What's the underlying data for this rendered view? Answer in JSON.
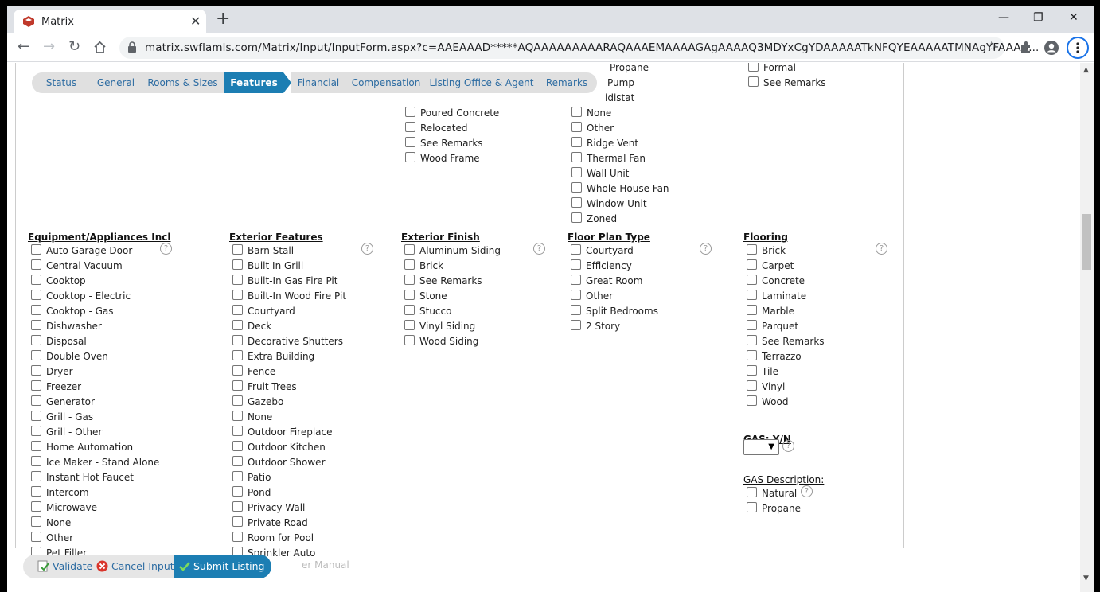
{
  "browser": {
    "tab_title": "Matrix",
    "url": "matrix.swflamls.com/Matrix/Input/InputForm.aspx?c=AAEAAAD*****AQAAAAAAAAARAQAAAEMAAAAGAgAAAAQ3MDYxCgYDAAAAATkNFQYEAAAAATMNAgYFAAAA...",
    "minimize": "—",
    "restore": "❐",
    "close": "✕",
    "new_tab": "+",
    "tab_close": "✕"
  },
  "steps": [
    "Status",
    "General",
    "Rooms & Sizes",
    "Features",
    "Financial",
    "Compensation",
    "Listing Office & Agent",
    "Remarks"
  ],
  "active_step": "Features",
  "top_partial": {
    "col3": [
      "Poured Concrete",
      "Relocated",
      "See Remarks",
      "Wood Frame"
    ],
    "col4_text": [
      "Propane",
      "Pump",
      "idistat"
    ],
    "col4": [
      "None",
      "Other",
      "Ridge Vent",
      "Thermal Fan",
      "Wall Unit",
      "Whole House Fan",
      "Window Unit",
      "Zoned"
    ],
    "col5_text": [
      "Formal"
    ],
    "col5": [
      "See Remarks"
    ]
  },
  "sections": {
    "equipment": {
      "title": "Equipment/Appliances Incl",
      "items": [
        "Auto Garage Door",
        "Central Vacuum",
        "Cooktop",
        "Cooktop - Electric",
        "Cooktop - Gas",
        "Dishwasher",
        "Disposal",
        "Double Oven",
        "Dryer",
        "Freezer",
        "Generator",
        "Grill - Gas",
        "Grill - Other",
        "Home Automation",
        "Ice Maker - Stand Alone",
        "Instant Hot Faucet",
        "Intercom",
        "Microwave",
        "None",
        "Other",
        "Pet Filler"
      ]
    },
    "exterior_features": {
      "title": "Exterior Features",
      "items": [
        "Barn Stall",
        "Built In Grill",
        "Built-In Gas Fire Pit",
        "Built-In Wood Fire Pit",
        "Courtyard",
        "Deck",
        "Decorative Shutters",
        "Extra Building",
        "Fence",
        "Fruit Trees",
        "Gazebo",
        "None",
        "Outdoor Fireplace",
        "Outdoor Kitchen",
        "Outdoor Shower",
        "Patio",
        "Pond",
        "Privacy Wall",
        "Private Road",
        "Room for Pool",
        "Sprinkler Auto"
      ]
    },
    "exterior_finish": {
      "title": "Exterior Finish",
      "items": [
        "Aluminum Siding",
        "Brick",
        "See Remarks",
        "Stone",
        "Stucco",
        "Vinyl Siding",
        "Wood Siding"
      ]
    },
    "floor_plan": {
      "title": "Floor Plan Type",
      "items": [
        "Courtyard",
        "Efficiency",
        "Great Room",
        "Other",
        "Split Bedrooms",
        "2 Story"
      ]
    },
    "flooring": {
      "title": "Flooring",
      "items": [
        "Brick",
        "Carpet",
        "Concrete",
        "Laminate",
        "Marble",
        "Parquet",
        "See Remarks",
        "Terrazzo",
        "Tile",
        "Vinyl",
        "Wood"
      ]
    }
  },
  "gas_yn": {
    "label": "GAS: Y/N",
    "value": ""
  },
  "gas_desc": {
    "label": "GAS Description:",
    "items": [
      "Natural",
      "Propane"
    ]
  },
  "help_glyph": "?",
  "footer": {
    "validate": "Validate",
    "cancel": "Cancel Input",
    "submit": "Submit Listing",
    "behind_text": "er Manual"
  }
}
